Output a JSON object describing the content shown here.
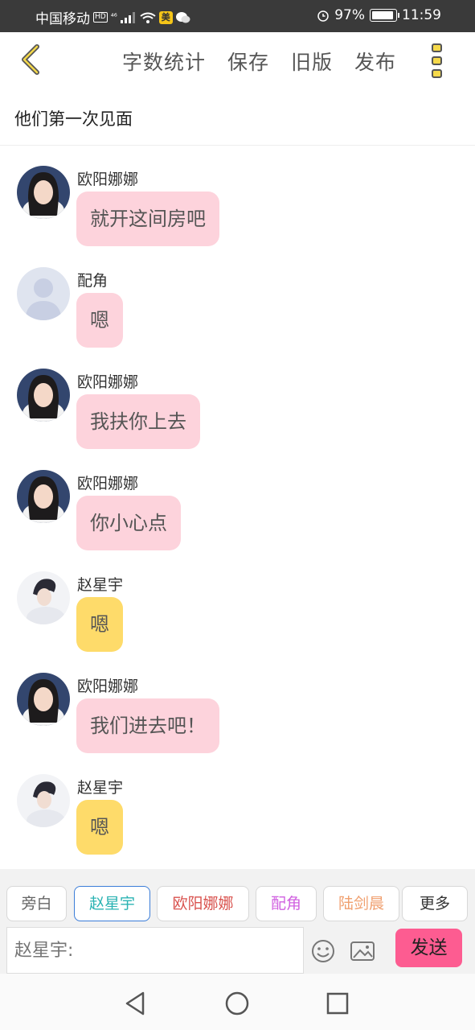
{
  "status_bar": {
    "carrier": "中国移动",
    "hd_badge": "HD",
    "network": "⁴⁶",
    "app_badge": "美",
    "battery_text": "97%",
    "battery_level": 0.97,
    "time": "11:59"
  },
  "header": {
    "actions": [
      "字数统计",
      "保存",
      "旧版",
      "发布"
    ]
  },
  "chapter_title": "他们第一次见面",
  "messages": [
    {
      "sender": "欧阳娜娜",
      "text": "就开这间房吧",
      "bubble": "pink",
      "avatar": "girl-avatar"
    },
    {
      "sender": "配角",
      "text": "嗯",
      "bubble": "pink",
      "avatar": "default-avatar"
    },
    {
      "sender": "欧阳娜娜",
      "text": "我扶你上去",
      "bubble": "pink",
      "avatar": "girl-avatar"
    },
    {
      "sender": "欧阳娜娜",
      "text": "你小心点",
      "bubble": "pink",
      "avatar": "girl-avatar"
    },
    {
      "sender": "赵星宇",
      "text": "嗯",
      "bubble": "yellow",
      "avatar": "boy-avatar"
    },
    {
      "sender": "欧阳娜娜",
      "text": "我们进去吧！",
      "bubble": "pink",
      "avatar": "girl-avatar"
    },
    {
      "sender": "赵星宇",
      "text": "嗯",
      "bubble": "yellow",
      "avatar": "boy-avatar"
    }
  ],
  "roles": [
    {
      "label": "旁白",
      "color": "#666666"
    },
    {
      "label": "赵星宇",
      "color": "#2bb3b3"
    },
    {
      "label": "欧阳娜娜",
      "color": "#d9534f"
    },
    {
      "label": "配角",
      "color": "#d060e0"
    },
    {
      "label": "陆剑晨",
      "color": "#f0a070"
    },
    {
      "label": "更多",
      "color": "#333333"
    }
  ],
  "composer": {
    "placeholder": "赵星宇:",
    "send_label": "发送"
  },
  "colors": {
    "pink_bubble": "#fdd3dc",
    "yellow_bubble": "#fedb6a",
    "send_button": "#fd5c91",
    "active_role_border": "#3b7dd8"
  },
  "icons": {
    "back": "chevron-left-icon",
    "more": "more-vertical-icon",
    "emoji": "smile-icon",
    "image": "image-icon",
    "nav_back": "triangle-back-icon",
    "nav_home": "circle-home-icon",
    "nav_recent": "square-recent-icon"
  }
}
